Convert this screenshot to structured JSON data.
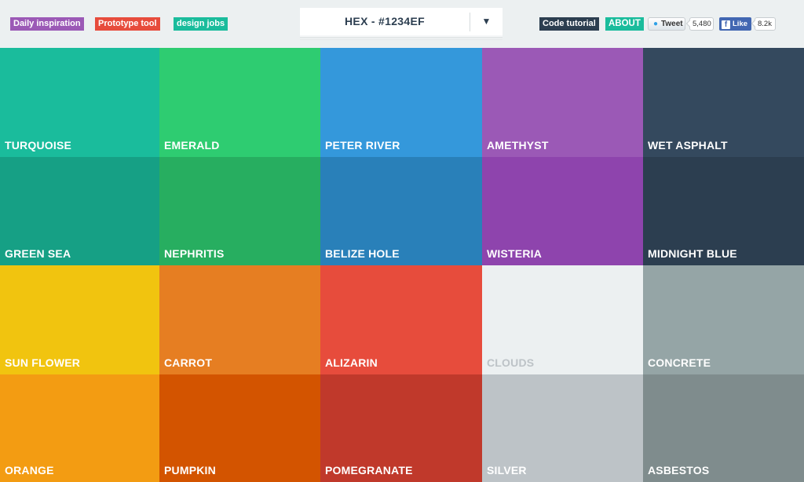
{
  "header": {
    "tags_left": [
      {
        "label": "Daily inspiration",
        "color": "#9b59b6"
      },
      {
        "label": "Prototype tool",
        "color": "#e74c3c"
      },
      {
        "label": "design jobs",
        "color": "#1abc9c"
      }
    ],
    "format_select": {
      "value": "HEX - #1234EF",
      "caret": "▼"
    },
    "tags_right": [
      {
        "label": "Code tutorial",
        "color": "#2c3e50"
      },
      {
        "label": "ABOUT",
        "color": "#1abc9c"
      }
    ],
    "social": {
      "tweet": {
        "icon": "twitter-bird-icon",
        "glyph": "🐦",
        "label": "Tweet",
        "count": "5,480"
      },
      "like": {
        "icon": "facebook-icon",
        "glyph": "f",
        "label": "Like",
        "count": "8.2k"
      }
    }
  },
  "palette": {
    "rows": [
      [
        {
          "name": "TURQUOISE",
          "hex": "#1abc9c"
        },
        {
          "name": "EMERALD",
          "hex": "#2ecc71"
        },
        {
          "name": "PETER RIVER",
          "hex": "#3498db"
        },
        {
          "name": "AMETHYST",
          "hex": "#9b59b6"
        },
        {
          "name": "WET ASPHALT",
          "hex": "#34495e"
        }
      ],
      [
        {
          "name": "GREEN SEA",
          "hex": "#16a085"
        },
        {
          "name": "NEPHRITIS",
          "hex": "#27ae60"
        },
        {
          "name": "BELIZE HOLE",
          "hex": "#2980b9"
        },
        {
          "name": "WISTERIA",
          "hex": "#8e44ad"
        },
        {
          "name": "MIDNIGHT BLUE",
          "hex": "#2c3e50"
        }
      ],
      [
        {
          "name": "SUN FLOWER",
          "hex": "#f1c40f"
        },
        {
          "name": "CARROT",
          "hex": "#e67e22"
        },
        {
          "name": "ALIZARIN",
          "hex": "#e74c3c"
        },
        {
          "name": "CLOUDS",
          "hex": "#ecf0f1",
          "light": true
        },
        {
          "name": "CONCRETE",
          "hex": "#95a5a6"
        }
      ],
      [
        {
          "name": "ORANGE",
          "hex": "#f39c12"
        },
        {
          "name": "PUMPKIN",
          "hex": "#d35400"
        },
        {
          "name": "POMEGRANATE",
          "hex": "#c0392b"
        },
        {
          "name": "SILVER",
          "hex": "#bdc3c7"
        },
        {
          "name": "ASBESTOS",
          "hex": "#7f8c8d"
        }
      ]
    ]
  }
}
